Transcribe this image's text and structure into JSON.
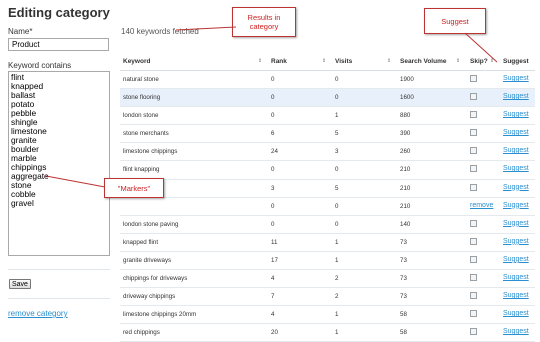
{
  "page": {
    "title": "Editing category"
  },
  "form": {
    "name_label": "Name*",
    "name_value": "Product",
    "keywords_label": "Keyword contains",
    "keywords": [
      "flint",
      "knapped",
      "ballast",
      "potato",
      "pebble",
      "shingle",
      "limestone",
      "granite",
      "boulder",
      "marble",
      "chippings",
      "aggregate",
      "stone",
      "cobble",
      "gravel"
    ],
    "save_label": "Save",
    "remove_category_label": "remove category"
  },
  "results": {
    "status": "140 keywords fetched",
    "columns": [
      "Keyword",
      "Rank",
      "Visits",
      "Search Volume",
      "Skip?",
      "Suggest"
    ],
    "rows": [
      {
        "keyword": "natural stone",
        "rank": "0",
        "visits": "0",
        "volume": "1900",
        "remove": "",
        "suggest": "Suggest"
      },
      {
        "keyword": "stone flooring",
        "rank": "0",
        "visits": "0",
        "volume": "1600",
        "remove": "",
        "suggest": "Suggest"
      },
      {
        "keyword": "london stone",
        "rank": "0",
        "visits": "1",
        "volume": "880",
        "remove": "",
        "suggest": "Suggest"
      },
      {
        "keyword": "stone merchants",
        "rank": "6",
        "visits": "5",
        "volume": "390",
        "remove": "",
        "suggest": "Suggest"
      },
      {
        "keyword": "limestone chippings",
        "rank": "24",
        "visits": "3",
        "volume": "260",
        "remove": "",
        "suggest": "Suggest"
      },
      {
        "keyword": "flint knapping",
        "rank": "0",
        "visits": "0",
        "volume": "210",
        "remove": "",
        "suggest": "Suggest"
      },
      {
        "keyword": "",
        "rank": "3",
        "visits": "5",
        "volume": "210",
        "remove": "",
        "suggest": "Suggest"
      },
      {
        "keyword": "",
        "rank": "0",
        "visits": "0",
        "volume": "210",
        "remove": "remove",
        "suggest": "Suggest"
      },
      {
        "keyword": "london stone paving",
        "rank": "0",
        "visits": "0",
        "volume": "140",
        "remove": "",
        "suggest": "Suggest"
      },
      {
        "keyword": "knapped flint",
        "rank": "11",
        "visits": "1",
        "volume": "73",
        "remove": "",
        "suggest": "Suggest"
      },
      {
        "keyword": "granite driveways",
        "rank": "17",
        "visits": "1",
        "volume": "73",
        "remove": "",
        "suggest": "Suggest"
      },
      {
        "keyword": "chippings for driveways",
        "rank": "4",
        "visits": "2",
        "volume": "73",
        "remove": "",
        "suggest": "Suggest"
      },
      {
        "keyword": "driveway chippings",
        "rank": "7",
        "visits": "2",
        "volume": "73",
        "remove": "",
        "suggest": "Suggest"
      },
      {
        "keyword": "limestone chippings 20mm",
        "rank": "4",
        "visits": "1",
        "volume": "58",
        "remove": "",
        "suggest": "Suggest"
      },
      {
        "keyword": "red chippings",
        "rank": "20",
        "visits": "1",
        "volume": "58",
        "remove": "",
        "suggest": "Suggest"
      }
    ]
  },
  "callouts": {
    "results": "Results in category",
    "suggest": "Suggest",
    "markers": "\"Markers\""
  },
  "colors": {
    "link": "#2a8fd0",
    "callout_text": "#cc2222",
    "row_highlight": "#e8f1fb"
  }
}
